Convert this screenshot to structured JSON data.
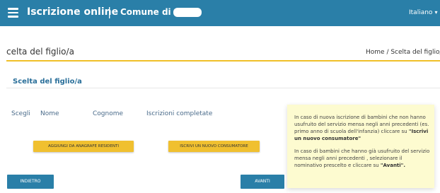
{
  "header": {
    "title": "Iscrizione online",
    "separator": "|",
    "comune_label": "Comune di",
    "language": "Italiano",
    "colors": {
      "bar": "#2a7fa8",
      "text": "#ffffff"
    }
  },
  "page": {
    "title": "celta del figlio/a",
    "breadcrumb": {
      "home": "Home",
      "separator": " / ",
      "current": "Scelta del figlio/"
    }
  },
  "section": {
    "title": "Scelta del figlio/a"
  },
  "table": {
    "headers": [
      "Scegli",
      "Nome",
      "Cognome",
      "Iscrizioni completate"
    ]
  },
  "buttons": {
    "add_from_registry": "AGGIUNGI DA ANAGRAFE RESIDENTI",
    "new_consumer": "ISCRIVI UN NUOVO CONSUMATORE",
    "back": "INDIETRO",
    "next": "AVANTI"
  },
  "info": {
    "p1_text": "In caso di nuova iscrizione di bambini che non hanno usufruito del servizio mensa negli anni precedenti (es. primo anno di scuola dell'infanzia) cliccare su ",
    "p1_strong": "\"Iscrivi un nuovo consumatore\"",
    "p2_text": "In caso di  bambini che hanno già usufruito del servizio mensa negli anni precedenti , selezionare il nominativo prescelto e cliccare su ",
    "p2_strong": "\"Avanti\"."
  },
  "colors": {
    "accent_yellow": "#f0c030",
    "primary_blue": "#2a7fa8",
    "info_background": "#fdfbd0"
  }
}
